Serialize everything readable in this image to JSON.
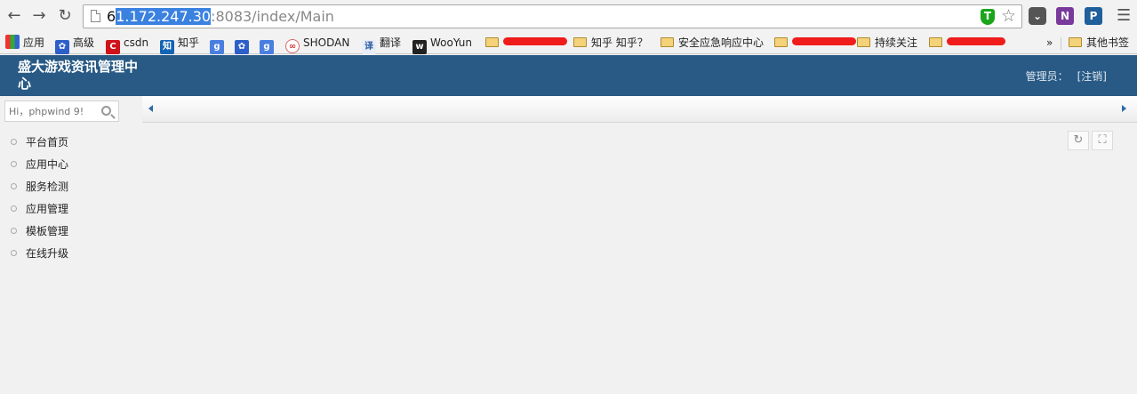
{
  "browser": {
    "url_prefix": "6",
    "url_selected": "1.172.247.30",
    "url_rest": ":8083/index/Main",
    "shield_letter": "T",
    "ext_note_letter": "N",
    "ext_blue_letter": "P"
  },
  "bookmarks": [
    {
      "label": "应用",
      "icon": "apps-grid-icon"
    },
    {
      "label": "高级",
      "icon": "baidu-paw-icon"
    },
    {
      "label": "csdn",
      "icon": "csdn-icon"
    },
    {
      "label": "知乎",
      "icon": "zhihu-icon"
    },
    {
      "label": "",
      "icon": "google-g-icon"
    },
    {
      "label": "",
      "icon": "baidu-paw-icon"
    },
    {
      "label": "",
      "icon": "google-g-icon"
    },
    {
      "label": "SHODAN",
      "icon": "shodan-icon"
    },
    {
      "label": "翻译",
      "icon": "translate-icon"
    },
    {
      "label": "WooYun",
      "icon": "wooyun-icon"
    },
    {
      "label": "知乎 知乎？",
      "icon": "folder-icon"
    },
    {
      "label": "安全应急响应中心",
      "icon": "folder-icon"
    },
    {
      "label": "持续关注",
      "icon": "folder-icon"
    },
    {
      "label": "»",
      "icon": ""
    },
    {
      "label": "其他书签",
      "icon": "folder-icon"
    }
  ],
  "header": {
    "title": "盛大游戏资讯管理中心",
    "admin_label": "管理员：",
    "logout": "[注销]"
  },
  "sidebar": {
    "search_placeholder": "Hi，phpwind 9!",
    "items": [
      {
        "label": "平台首页"
      },
      {
        "label": "应用中心"
      },
      {
        "label": "服务检测"
      },
      {
        "label": "应用管理"
      },
      {
        "label": "模板管理"
      },
      {
        "label": "在线升级"
      }
    ]
  },
  "colors": {
    "header_bg": "#285a85",
    "accent": "#2b6aa8"
  }
}
